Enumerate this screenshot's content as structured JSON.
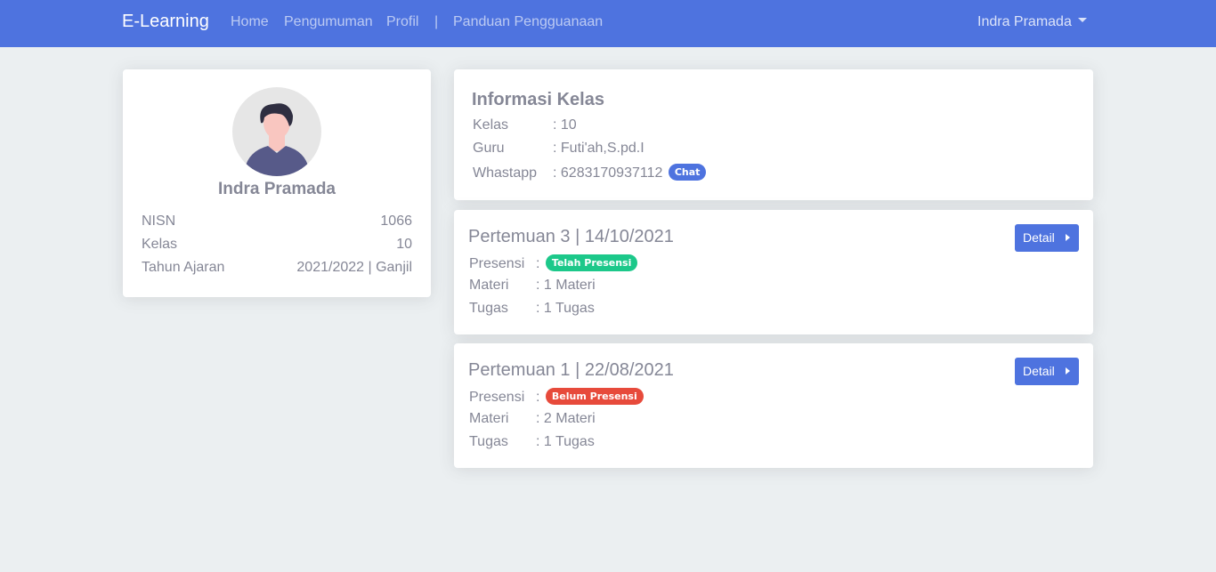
{
  "nav": {
    "brand": "E-Learning",
    "links": [
      "Home",
      "Pengumuman",
      "Profil",
      "|",
      "Panduan Pengguanaan"
    ],
    "user": "Indra Pramada"
  },
  "profile": {
    "name": "Indra Pramada",
    "rows": [
      {
        "label": "NISN",
        "value": "1066"
      },
      {
        "label": "Kelas",
        "value": "10"
      },
      {
        "label": "Tahun Ajaran",
        "value": "2021/2022 | Ganjil"
      }
    ]
  },
  "info": {
    "title": "Informasi Kelas",
    "kelas_label": "Kelas",
    "kelas_value": ": 10",
    "guru_label": "Guru",
    "guru_value": ": Futi'ah,S.pd.I",
    "wa_label": "Whastapp",
    "wa_value": ": 6283170937112",
    "chat_label": "Chat"
  },
  "meetings": [
    {
      "title": "Pertemuan 3 | 14/10/2021",
      "presensi_label": "Presensi",
      "presensi_sep": ":",
      "presensi_badge": "Telah Presensi",
      "presensi_status": "success",
      "materi_label": "Materi",
      "materi_value": ": 1 Materi",
      "tugas_label": "Tugas",
      "tugas_value": ": 1 Tugas",
      "detail_label": "Detail"
    },
    {
      "title": "Pertemuan 1 | 22/08/2021",
      "presensi_label": "Presensi",
      "presensi_sep": ":",
      "presensi_badge": "Belum Presensi",
      "presensi_status": "danger",
      "materi_label": "Materi",
      "materi_value": ": 2 Materi",
      "tugas_label": "Tugas",
      "tugas_value": ": 1 Tugas",
      "detail_label": "Detail"
    }
  ],
  "colors": {
    "primary": "#4e73df",
    "success": "#1cc88a",
    "danger": "#e74a3b",
    "background": "#ebeff1",
    "text": "#858796"
  }
}
